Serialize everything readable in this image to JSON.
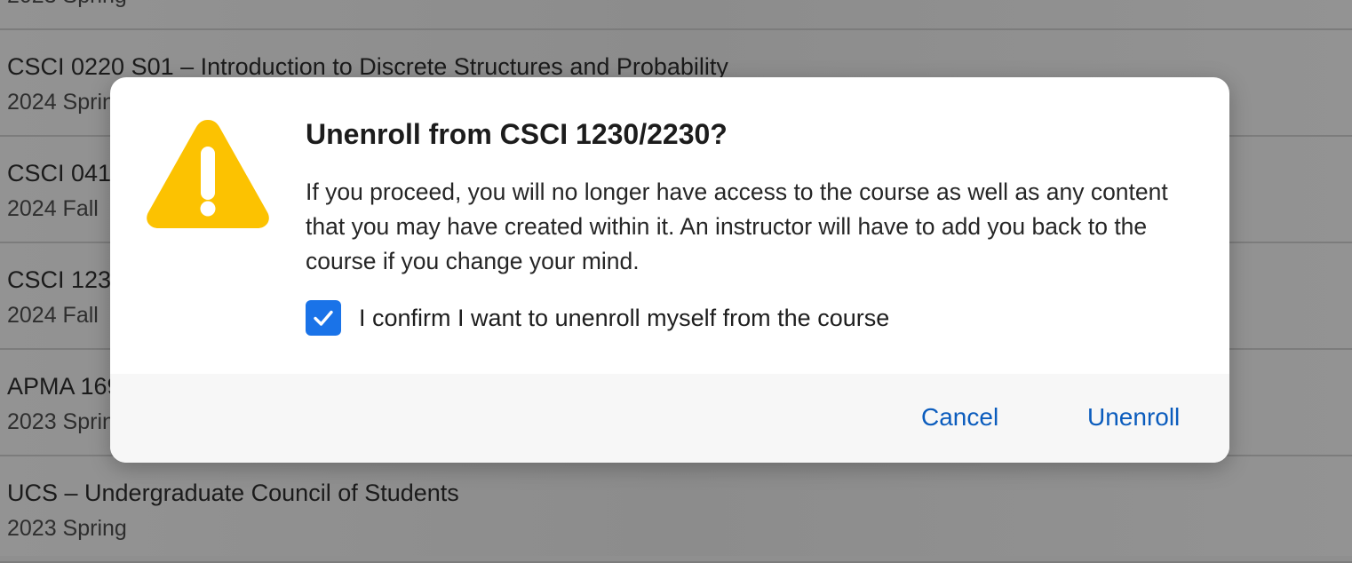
{
  "courses": [
    {
      "title": "CSCI 0220 S01 – Introduction to Discrete Structures and Probability",
      "term": "2024 Spring"
    },
    {
      "title": "CSCI 0410",
      "term": "2024 Fall"
    },
    {
      "title": "CSCI 1230",
      "term": "2024 Fall"
    },
    {
      "title": "APMA 1690",
      "term": "2023 Spring"
    },
    {
      "title": "UCS – Undergraduate Council of Students",
      "term": "2023 Spring"
    }
  ],
  "partial_top_term": "2023 Spring",
  "dialog": {
    "icon": "warning-triangle-icon",
    "icon_color": "#fcc201",
    "title": "Unenroll from CSCI 1230/2230?",
    "body": "If you proceed, you will no longer have access to the course as well as any content that you may have created within it. An instructor will have to add you back to the course if you change your mind.",
    "confirm_label": "I confirm I want to unenroll myself from the course",
    "confirm_checked": true,
    "cancel_label": "Cancel",
    "unenroll_label": "Unenroll",
    "accent_color": "#1a73e8",
    "link_color": "#0b5cbd"
  }
}
